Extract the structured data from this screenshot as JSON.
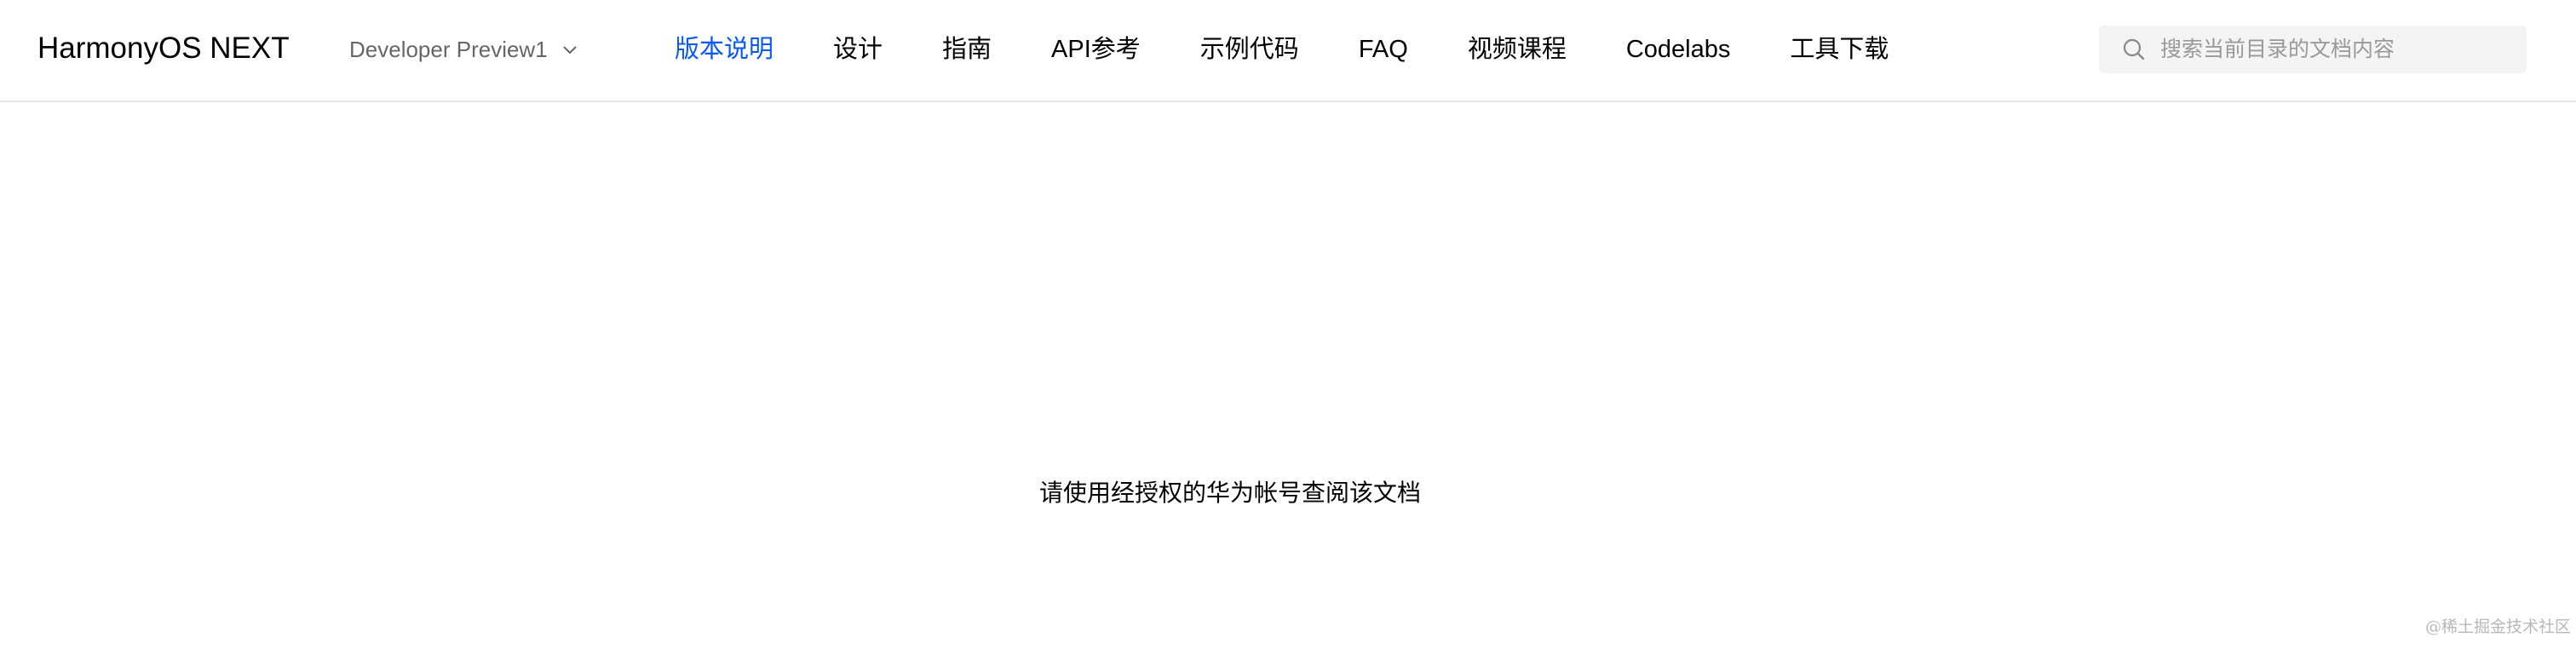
{
  "header": {
    "brand": "HarmonyOS NEXT",
    "version_selector": {
      "label": "Developer Preview1",
      "icon": "chevron-down-icon"
    },
    "nav": [
      {
        "label": "版本说明",
        "active": true
      },
      {
        "label": "设计",
        "active": false
      },
      {
        "label": "指南",
        "active": false
      },
      {
        "label": "API参考",
        "active": false
      },
      {
        "label": "示例代码",
        "active": false
      },
      {
        "label": "FAQ",
        "active": false
      },
      {
        "label": "视频课程",
        "active": false
      },
      {
        "label": "Codelabs",
        "active": false
      },
      {
        "label": "工具下载",
        "active": false
      }
    ],
    "search": {
      "placeholder": "搜索当前目录的文档内容",
      "value": "",
      "icon": "search-icon"
    }
  },
  "main": {
    "message": "请使用经授权的华为帐号查阅该文档"
  },
  "watermark": "@稀土掘金技术社区",
  "colors": {
    "accent": "#0a59f7",
    "text": "#000000",
    "muted": "#666666",
    "search_bg": "#f4f4f4",
    "divider": "#e8e8e8"
  }
}
